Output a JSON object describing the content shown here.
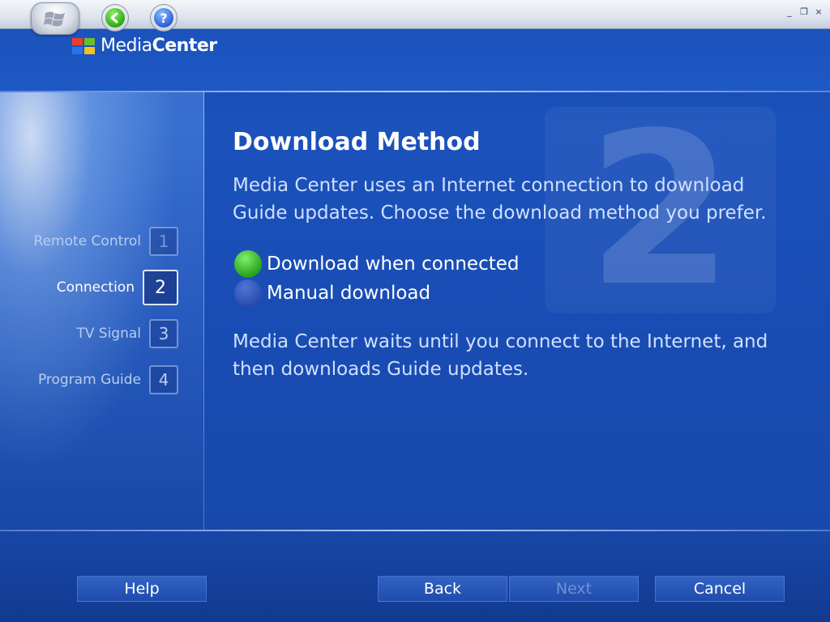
{
  "window": {
    "minimize": "_",
    "restore": "❐",
    "close": "×"
  },
  "logo": {
    "part1": "Media",
    "part2": "Center"
  },
  "steps": [
    {
      "label": "Remote Control",
      "num": "1"
    },
    {
      "label": "Connection",
      "num": "2"
    },
    {
      "label": "TV Signal",
      "num": "3"
    },
    {
      "label": "Program Guide",
      "num": "4"
    }
  ],
  "main": {
    "watermark_num": "2",
    "title": "Download Method",
    "description": "Media Center uses an Internet connection to download Guide updates. Choose the download method you prefer.",
    "options": [
      {
        "label": "Download when connected",
        "selected": true
      },
      {
        "label": "Manual download",
        "selected": false
      }
    ],
    "note": "Media Center waits until you connect to the Internet, and then downloads Guide updates."
  },
  "footer": {
    "help": "Help",
    "back": "Back",
    "next": "Next",
    "cancel": "Cancel"
  },
  "colors": {
    "accent": "#1f5cc9",
    "selected_radio": "#2ea822"
  },
  "icons": {
    "start": "windows-flag-icon",
    "back": "back-arrow-icon",
    "help": "help-question-icon"
  }
}
